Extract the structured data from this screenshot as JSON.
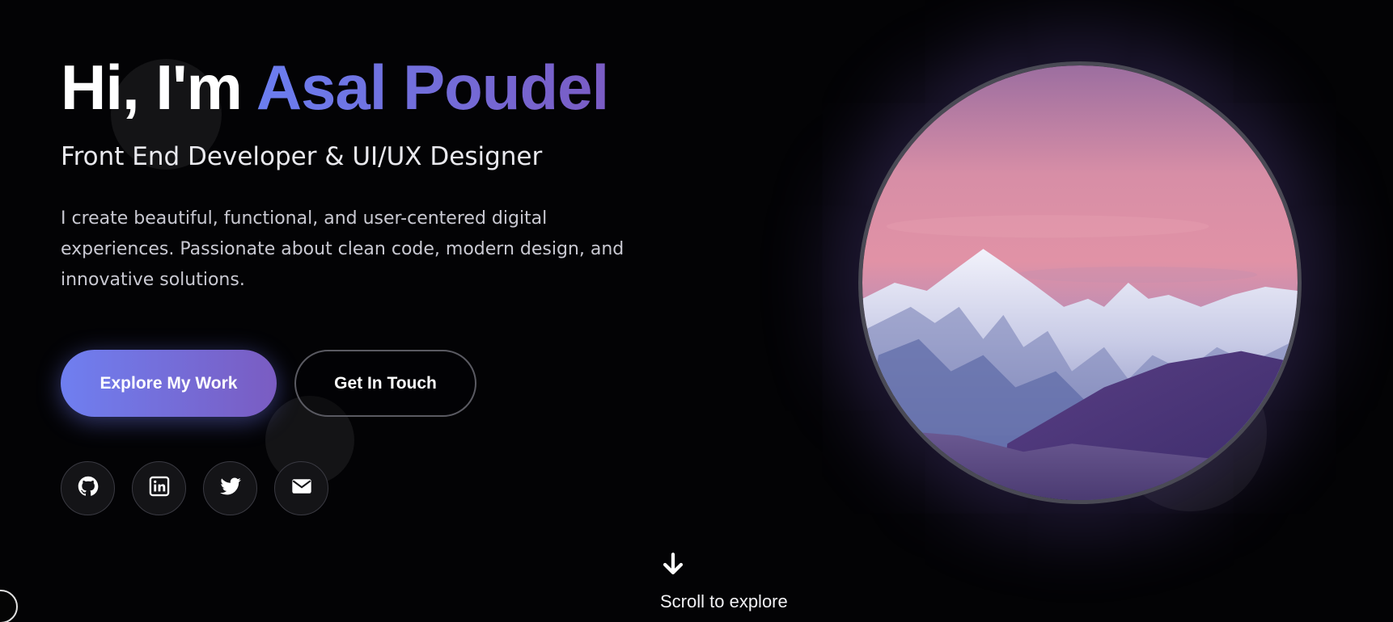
{
  "hero": {
    "greeting": "Hi, I'm",
    "name": "Asal Poudel",
    "subtitle": "Front End Developer & UI/UX Designer",
    "description": "I create beautiful, functional, and user-centered digital experiences. Passionate about clean code, modern design, and innovative solutions."
  },
  "buttons": {
    "primary_label": "Explore My Work",
    "secondary_label": "Get In Touch"
  },
  "socials": [
    {
      "name": "GitHub",
      "icon": "github-icon"
    },
    {
      "name": "LinkedIn",
      "icon": "linkedin-icon"
    },
    {
      "name": "Twitter",
      "icon": "twitter-icon"
    },
    {
      "name": "Email",
      "icon": "envelope-icon"
    }
  ],
  "portrait": {
    "image_subject": "snowy mountain range under pink sunset sky"
  },
  "scroll": {
    "label": "Scroll to explore",
    "icon": "arrow-down-icon"
  },
  "colors": {
    "background": "#030305",
    "accent_start": "#6f7ff0",
    "accent_end": "#7a5cc2"
  }
}
